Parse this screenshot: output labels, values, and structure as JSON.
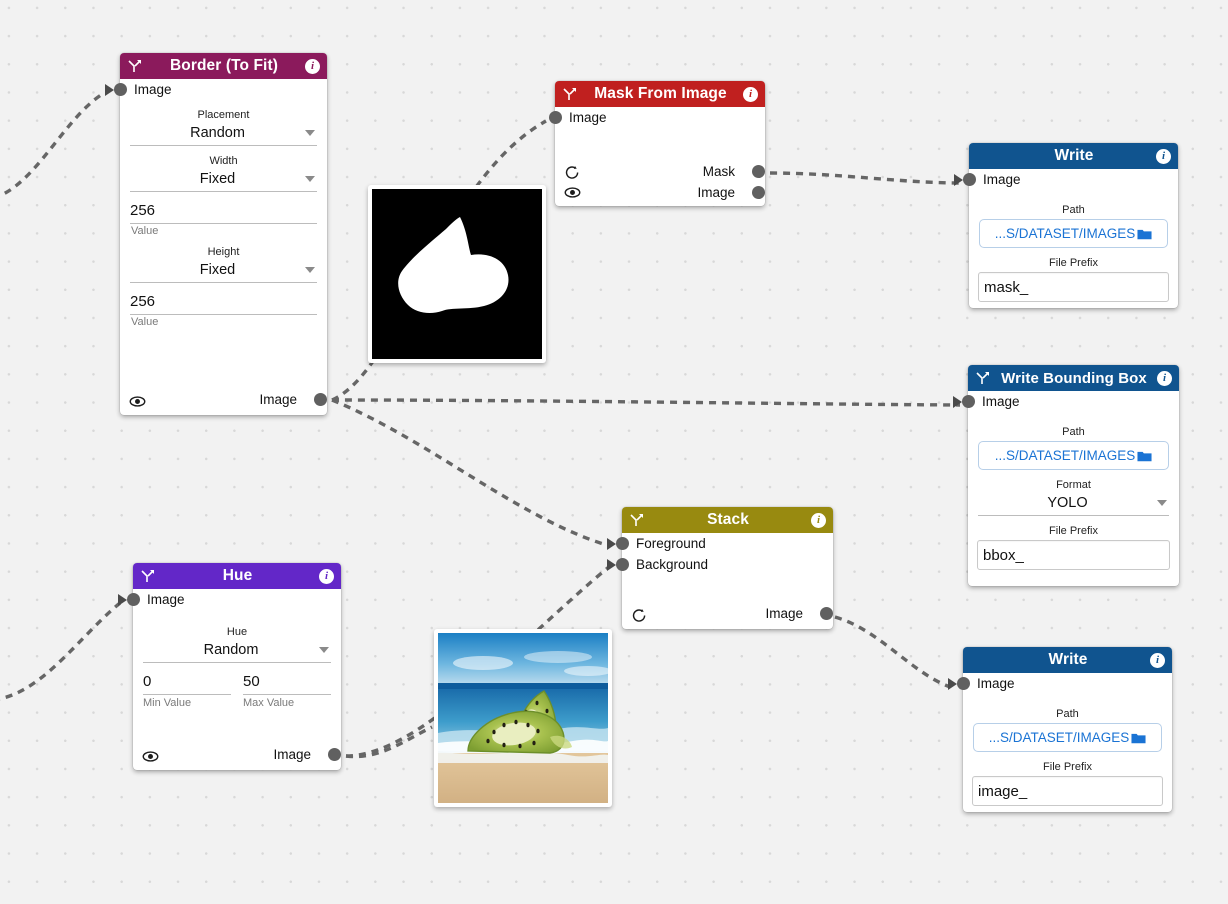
{
  "canvas": {
    "background_color": "#f2f2f2",
    "grid_dot_color": "#d8d8d8",
    "edge_color": "#666666"
  },
  "nodes": {
    "border": {
      "title": "Border (To Fit)",
      "header_color": "#8b1a5c",
      "branch_icon": "branch-arrow-icon",
      "info_icon": "info-icon",
      "inputs": [
        {
          "label": "Image"
        }
      ],
      "outputs": [
        {
          "label": "Image"
        }
      ],
      "fields": {
        "placement_label": "Placement",
        "placement_value": "Random",
        "width_label": "Width",
        "width_mode": "Fixed",
        "width_value": "256",
        "width_sublabel": "Value",
        "height_label": "Height",
        "height_mode": "Fixed",
        "height_value": "256",
        "height_sublabel": "Value"
      },
      "eye_icon": "eye-icon"
    },
    "mask_from_image": {
      "title": "Mask From Image",
      "header_color": "#c0201f",
      "branch_icon": "branch-arrow-icon",
      "info_icon": "info-icon",
      "inputs": [
        {
          "label": "Image"
        }
      ],
      "outputs": [
        {
          "label": "Mask"
        },
        {
          "label": "Image"
        }
      ],
      "refresh_icon": "refresh-icon",
      "eye_icon": "eye-icon"
    },
    "write_mask": {
      "title": "Write",
      "header_color": "#10548f",
      "info_icon": "info-icon",
      "inputs": [
        {
          "label": "Image"
        }
      ],
      "fields": {
        "path_label": "Path",
        "path_value": "...S/DATASET/IMAGES",
        "folder_icon": "folder-icon",
        "prefix_label": "File Prefix",
        "prefix_value": "mask_"
      }
    },
    "write_bbox": {
      "title": "Write Bounding Box",
      "header_color": "#10548f",
      "branch_icon": "branch-arrow-icon",
      "info_icon": "info-icon",
      "inputs": [
        {
          "label": "Image"
        }
      ],
      "fields": {
        "path_label": "Path",
        "path_value": "...S/DATASET/IMAGES",
        "folder_icon": "folder-icon",
        "format_label": "Format",
        "format_value": "YOLO",
        "prefix_label": "File Prefix",
        "prefix_value": "bbox_"
      }
    },
    "stack": {
      "title": "Stack",
      "header_color": "#988a10",
      "branch_icon": "branch-arrow-icon",
      "info_icon": "info-icon",
      "inputs": [
        {
          "label": "Foreground"
        },
        {
          "label": "Background"
        }
      ],
      "outputs": [
        {
          "label": "Image"
        }
      ],
      "refresh_icon": "refresh-icon"
    },
    "hue": {
      "title": "Hue",
      "header_color": "#6327c8",
      "branch_icon": "branch-arrow-icon",
      "info_icon": "info-icon",
      "inputs": [
        {
          "label": "Image"
        }
      ],
      "outputs": [
        {
          "label": "Image"
        }
      ],
      "fields": {
        "hue_label": "Hue",
        "hue_mode": "Random",
        "min_value": "0",
        "min_sublabel": "Min Value",
        "max_value": "50",
        "max_sublabel": "Max Value"
      },
      "eye_icon": "eye-icon"
    },
    "write_image": {
      "title": "Write",
      "header_color": "#10548f",
      "info_icon": "info-icon",
      "inputs": [
        {
          "label": "Image"
        }
      ],
      "fields": {
        "path_label": "Path",
        "path_value": "...S/DATASET/IMAGES",
        "folder_icon": "folder-icon",
        "prefix_label": "File Prefix",
        "prefix_value": "image_"
      }
    }
  },
  "previews": {
    "mask_preview": {
      "name": "mask-preview-image",
      "description": "black background with white blob mask"
    },
    "photo_preview": {
      "name": "kiwi-beach-preview-image",
      "description": "kiwi slices on a beach with ocean and sky"
    }
  }
}
